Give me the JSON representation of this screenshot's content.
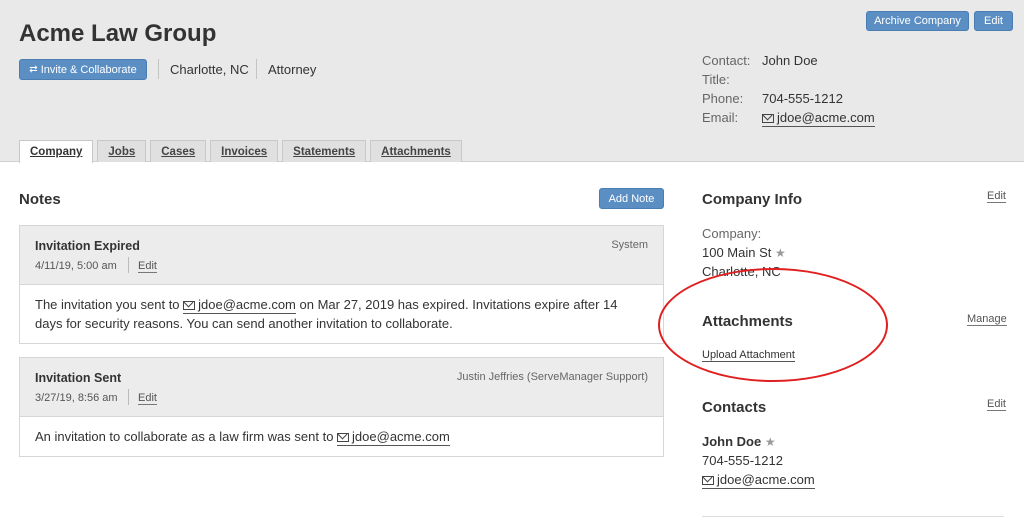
{
  "company": {
    "name": "Acme Law Group",
    "location": "Charlotte, NC",
    "type": "Attorney",
    "invite_label": "Invite & Collaborate"
  },
  "header_actions": {
    "archive_label": "Archive Company",
    "edit_label": "Edit"
  },
  "contact": {
    "contact_label": "Contact:",
    "contact_value": "John Doe",
    "title_label": "Title:",
    "title_value": "",
    "phone_label": "Phone:",
    "phone_value": "704-555-1212",
    "email_label": "Email:",
    "email_value": "jdoe@acme.com"
  },
  "tabs": [
    {
      "label": "Company",
      "active": true
    },
    {
      "label": "Jobs",
      "active": false
    },
    {
      "label": "Cases",
      "active": false
    },
    {
      "label": "Invoices",
      "active": false
    },
    {
      "label": "Statements",
      "active": false
    },
    {
      "label": "Attachments",
      "active": false
    }
  ],
  "notes": {
    "title": "Notes",
    "add_label": "Add Note",
    "items": [
      {
        "title": "Invitation Expired",
        "date": "4/11/19, 5:00 am",
        "edit": "Edit",
        "author": "System",
        "body_pre": "The invitation you sent to ",
        "body_email": "jdoe@acme.com",
        "body_post": " on Mar 27, 2019 has expired. Invitations expire after 14 days for security reasons. You can send another invitation to collaborate."
      },
      {
        "title": "Invitation Sent",
        "date": "3/27/19, 8:56 am",
        "edit": "Edit",
        "author": "Justin Jeffries (ServeManager Support)",
        "body_pre": "An invitation to collaborate as a law firm was sent to ",
        "body_email": "jdoe@acme.com",
        "body_post": ""
      }
    ]
  },
  "company_info": {
    "title": "Company Info",
    "edit": "Edit",
    "label": "Company:",
    "address": "100 Main St",
    "star": "★",
    "city": "Charlotte, NC"
  },
  "attachments": {
    "title": "Attachments",
    "manage": "Manage",
    "upload": "Upload Attachment"
  },
  "contacts": {
    "title": "Contacts",
    "edit": "Edit",
    "name": "John Doe",
    "star": "★",
    "phone": "704-555-1212",
    "email": "jdoe@acme.com"
  }
}
